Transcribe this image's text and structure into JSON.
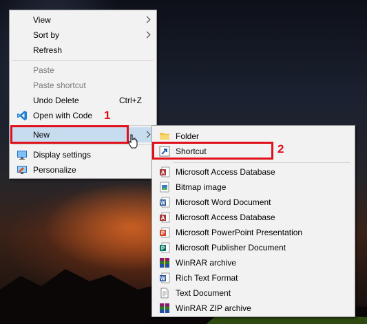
{
  "context_menu": {
    "items": [
      {
        "label": "View",
        "has_submenu": true
      },
      {
        "label": "Sort by",
        "has_submenu": true
      },
      {
        "label": "Refresh"
      },
      {
        "label": "Paste",
        "disabled": true
      },
      {
        "label": "Paste shortcut",
        "disabled": true
      },
      {
        "label": "Undo Delete",
        "shortcut": "Ctrl+Z"
      },
      {
        "label": "Open with Code",
        "icon": "vscode-icon"
      },
      {
        "label": "New",
        "has_submenu": true,
        "highlighted": true
      },
      {
        "label": "Display settings",
        "icon": "display-settings-icon"
      },
      {
        "label": "Personalize",
        "icon": "personalize-icon"
      }
    ]
  },
  "new_submenu": {
    "items": [
      {
        "label": "Folder",
        "icon": "folder-icon"
      },
      {
        "label": "Shortcut",
        "icon": "shortcut-icon"
      },
      {
        "label": "Microsoft Access Database",
        "icon": "access-icon"
      },
      {
        "label": "Bitmap image",
        "icon": "bitmap-icon"
      },
      {
        "label": "Microsoft Word Document",
        "icon": "word-icon"
      },
      {
        "label": "Microsoft Access Database",
        "icon": "access-icon"
      },
      {
        "label": "Microsoft PowerPoint Presentation",
        "icon": "powerpoint-icon"
      },
      {
        "label": "Microsoft Publisher Document",
        "icon": "publisher-icon"
      },
      {
        "label": "WinRAR archive",
        "icon": "winrar-icon"
      },
      {
        "label": "Rich Text Format",
        "icon": "rtf-icon"
      },
      {
        "label": "Text Document",
        "icon": "text-document-icon"
      },
      {
        "label": "WinRAR ZIP archive",
        "icon": "winrar-zip-icon"
      }
    ]
  },
  "annotations": {
    "step1": "1",
    "step2": "2"
  },
  "colors": {
    "highlight": "#e0101a",
    "menu_bg": "#f2f2f2"
  }
}
